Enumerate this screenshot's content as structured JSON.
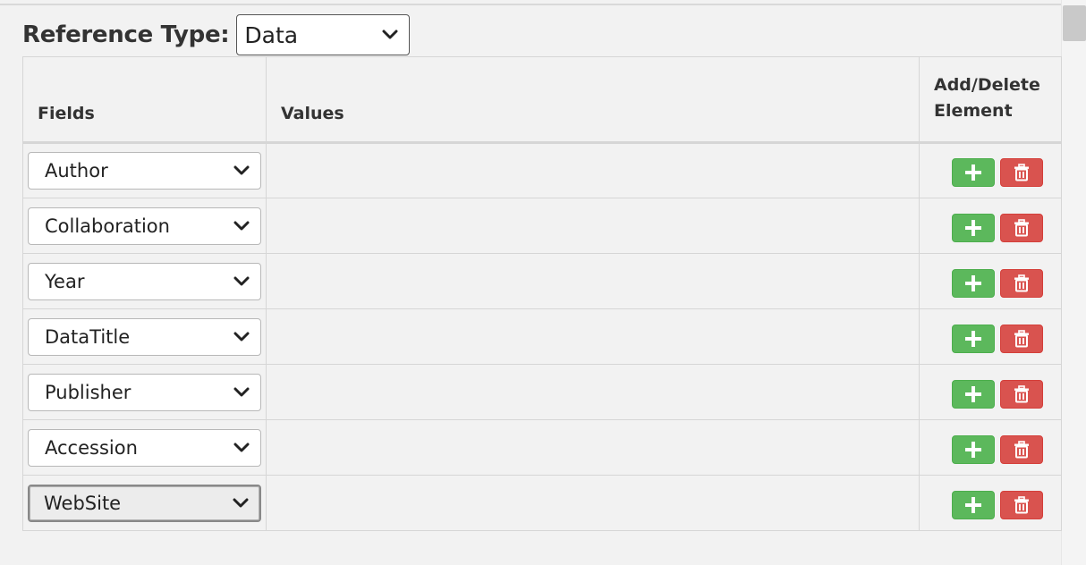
{
  "reference": {
    "label": "Reference Type:",
    "selected": "Data"
  },
  "table": {
    "headers": {
      "fields": "Fields",
      "values": "Values",
      "actions_line1": "Add/Delete",
      "actions_line2": "Element"
    },
    "rows": [
      {
        "field": "Author",
        "value": ""
      },
      {
        "field": "Collaboration",
        "value": ""
      },
      {
        "field": "Year",
        "value": ""
      },
      {
        "field": "DataTitle",
        "value": ""
      },
      {
        "field": "Publisher",
        "value": ""
      },
      {
        "field": "Accession",
        "value": ""
      },
      {
        "field": "WebSite",
        "value": ""
      }
    ]
  },
  "icons": {
    "add": "plus-icon",
    "delete": "trash-icon",
    "dropdown": "chevron-down-icon"
  },
  "colors": {
    "add_button": "#5cb85c",
    "delete_button": "#d9534f"
  }
}
